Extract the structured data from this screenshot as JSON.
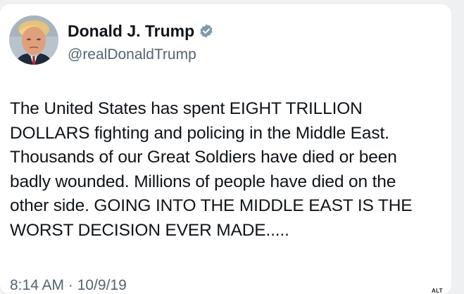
{
  "tweet": {
    "author": {
      "display_name": "Donald J. Trump",
      "handle": "@realDonaldTrump",
      "verified_icon": "verified-badge-icon",
      "avatar_icon": "profile-avatar"
    },
    "text": "The United States has spent EIGHT TRILLION\nDOLLARS fighting and policing in the Middle East.\nThousands of our Great Soldiers have died or been\nbadly wounded. Millions of people have died on the\nother side. GOING INTO THE MIDDLE EAST IS THE\nWORST DECISION EVER MADE.....",
    "timestamp": "8:14 AM · 10/9/19"
  },
  "image_badge": {
    "alt_label": "ALT"
  },
  "colors": {
    "text_primary": "#0f1419",
    "text_secondary": "#536471",
    "verified": "#829aab",
    "card_background": "#ffffff",
    "page_background": "#eef0f2"
  }
}
